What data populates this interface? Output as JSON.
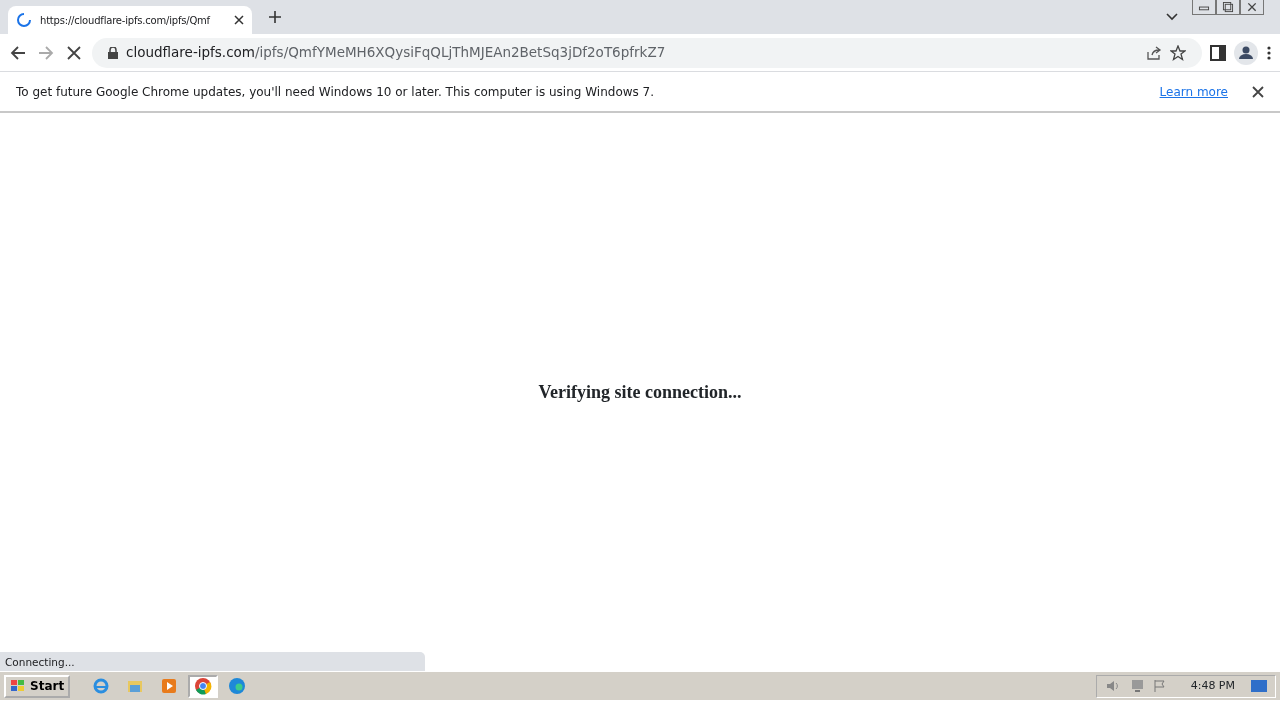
{
  "tabs": [
    {
      "title": "https://cloudflare-ipfs.com/ipfs/Qmf",
      "loading": true,
      "selected": true
    }
  ],
  "address_bar": {
    "domain": "cloudflare-ipfs.com",
    "path": "/ipfs/QmfYMeMH6XQysiFqQLjThMJEAn2BetSq3jDf2oT6pfrkZ7"
  },
  "info_bar": {
    "message": "To get future Google Chrome updates, you'll need Windows 10 or later. This computer is using Windows 7.",
    "link": "Learn more"
  },
  "page": {
    "heading": "Verifying site connection..."
  },
  "status_bubble": "Connecting...",
  "taskbar": {
    "start": "Start",
    "apps": [
      {
        "kind": "ie",
        "selected": false
      },
      {
        "kind": "folder",
        "selected": false
      },
      {
        "kind": "media",
        "selected": false
      },
      {
        "kind": "chrome",
        "selected": true
      },
      {
        "kind": "edge",
        "selected": false
      }
    ],
    "clock": "4:48 PM"
  }
}
